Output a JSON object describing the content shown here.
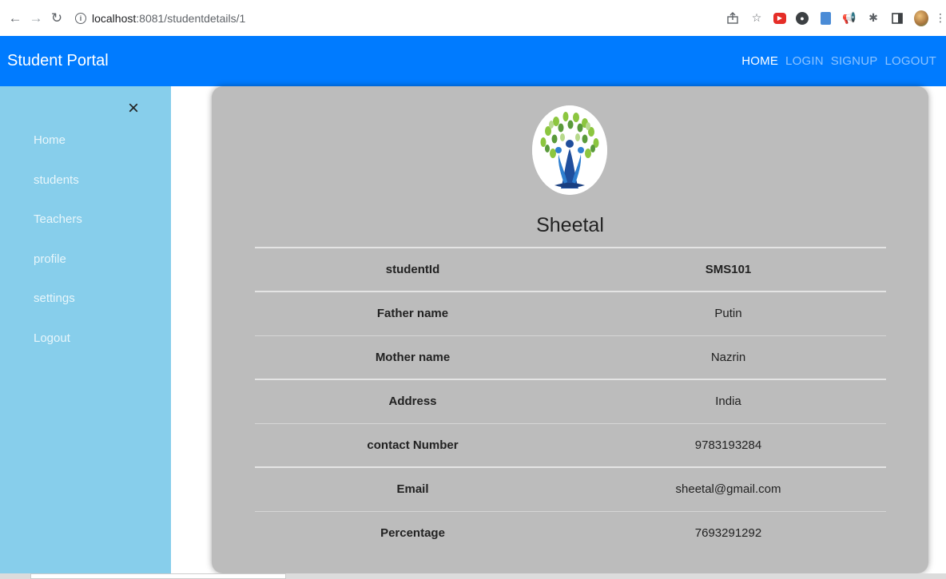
{
  "browser": {
    "url_host": "localhost",
    "url_path": ":8081/studentdetails/1"
  },
  "app": {
    "brand": "Student Portal",
    "nav": [
      {
        "label": "HOME",
        "active": true
      },
      {
        "label": "LOGIN"
      },
      {
        "label": "SIGNUP"
      },
      {
        "label": "LOGOUT"
      }
    ]
  },
  "sidebar": {
    "close_glyph": "×",
    "items": [
      {
        "label": "Home"
      },
      {
        "label": "students"
      },
      {
        "label": "Teachers"
      },
      {
        "label": "profile"
      },
      {
        "label": "settings"
      },
      {
        "label": "Logout"
      }
    ]
  },
  "student": {
    "name": "Sheetal",
    "details": [
      {
        "key": "studentId",
        "value": "SMS101"
      },
      {
        "key": "Father name",
        "value": "Putin"
      },
      {
        "key": "Mother name",
        "value": "Nazrin"
      },
      {
        "key": "Address",
        "value": "India"
      },
      {
        "key": "contact Number",
        "value": "9783193284"
      },
      {
        "key": "Email",
        "value": "sheetal@gmail.com"
      },
      {
        "key": "Percentage",
        "value": "7693291292"
      }
    ]
  },
  "icons": {
    "avatar": "tree-logo-icon"
  }
}
